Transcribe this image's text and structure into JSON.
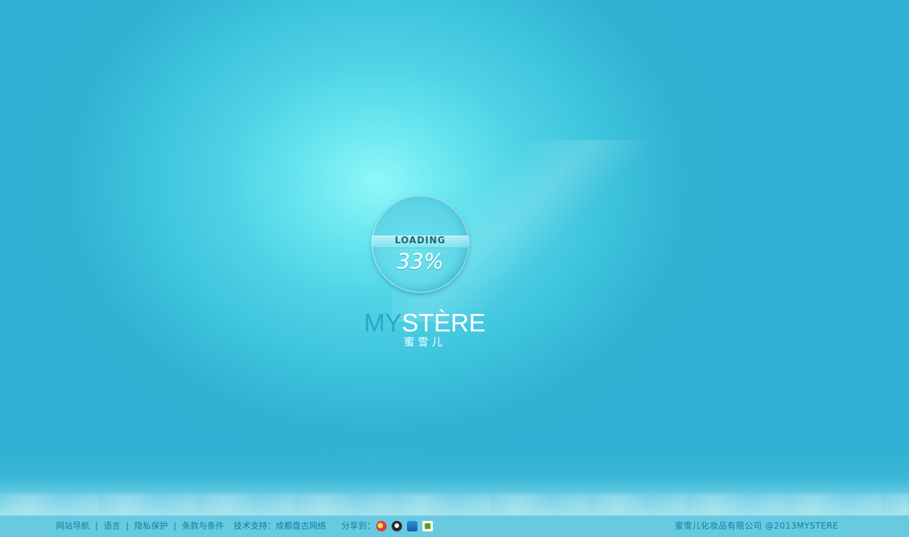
{
  "loader": {
    "label": "LOADING",
    "percent": "33%",
    "progress": 0.33
  },
  "brand": {
    "name_part1": "MY",
    "name_part2": "STÈRE",
    "name_cn": "蜜雪儿"
  },
  "footer": {
    "nav": [
      "网站导航",
      "语言",
      "隐私保护",
      "条款与条件"
    ],
    "separator": "|",
    "support_label": "技术支持：成都盘古网络",
    "share_label": "分享到：",
    "share_icons": [
      "weibo-icon",
      "tencent-weibo-icon",
      "renren-icon",
      "kaixin-icon"
    ],
    "copyright": "蜜雪儿化妆品有限公司 @2013MYSTERE"
  },
  "colors": {
    "background": "#31b2d3",
    "glow": "#8ff8f9",
    "brand_accent": "#2ea5c8",
    "footer_text": "#117f9d"
  }
}
